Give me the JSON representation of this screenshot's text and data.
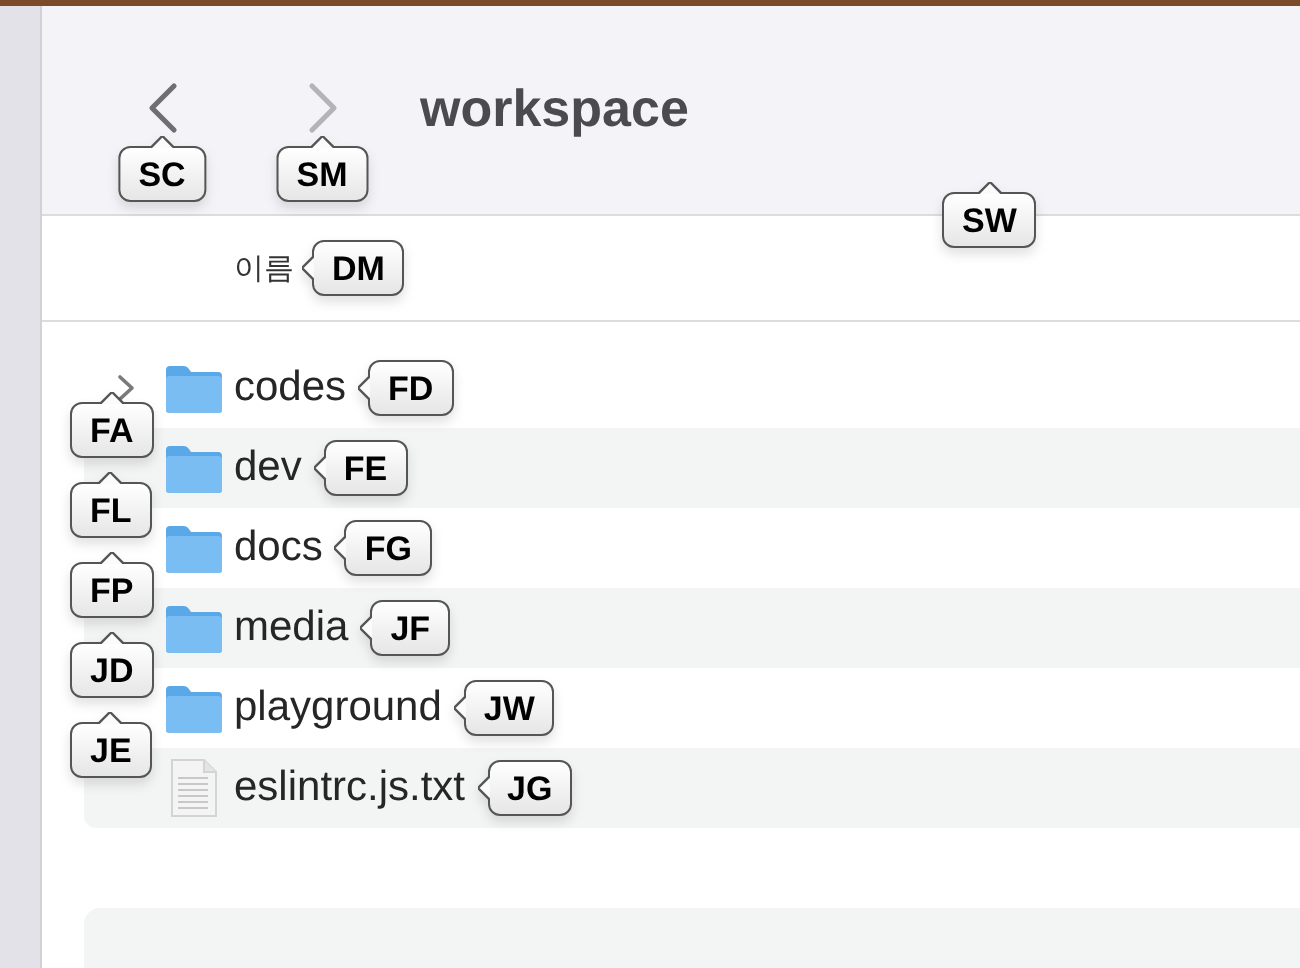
{
  "toolbar": {
    "back_button": {
      "disabled": false,
      "hint": "SC"
    },
    "forward_button": {
      "disabled": true,
      "hint": "SM"
    },
    "title": "workspace",
    "hint": "SW"
  },
  "column_header": {
    "label": "이름",
    "hint": "DM"
  },
  "files": [
    {
      "kind": "folder",
      "name": "codes",
      "disclosure": true,
      "icon_hint": "FA",
      "name_hint": "FD"
    },
    {
      "kind": "folder",
      "name": "dev",
      "disclosure": false,
      "icon_hint": "FL",
      "name_hint": "FE"
    },
    {
      "kind": "folder",
      "name": "docs",
      "disclosure": false,
      "icon_hint": "FP",
      "name_hint": "FG"
    },
    {
      "kind": "folder",
      "name": "media",
      "disclosure": false,
      "icon_hint": "JD",
      "name_hint": "JF"
    },
    {
      "kind": "folder",
      "name": "playground",
      "disclosure": false,
      "icon_hint": "JE",
      "name_hint": "JW"
    },
    {
      "kind": "text_file",
      "name": "eslintrc.js.txt",
      "disclosure": false,
      "name_hint": "JG"
    }
  ]
}
